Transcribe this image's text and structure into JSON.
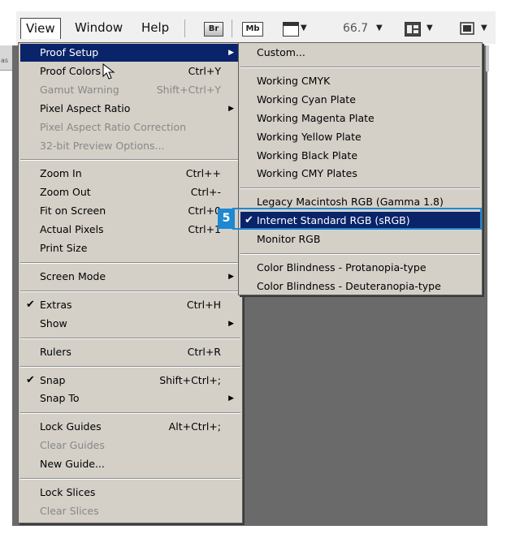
{
  "menubar": {
    "items": [
      "View",
      "Window",
      "Help"
    ],
    "bridge_button": "Br",
    "minibridge_button": "Mb",
    "zoom_value": "66.7",
    "left_sliver_text": "as"
  },
  "view_menu": [
    {
      "label": "Proof Setup",
      "arrow": true,
      "highlight": true
    },
    {
      "label": "Proof Colors",
      "shortcut": "Ctrl+Y"
    },
    {
      "label": "Gamut Warning",
      "shortcut": "Shift+Ctrl+Y",
      "disabled": true
    },
    {
      "label": "Pixel Aspect Ratio",
      "arrow": true
    },
    {
      "label": "Pixel Aspect Ratio Correction",
      "disabled": true
    },
    {
      "label": "32-bit Preview Options...",
      "disabled": true
    },
    {
      "divider": true
    },
    {
      "label": "Zoom In",
      "shortcut": "Ctrl++"
    },
    {
      "label": "Zoom Out",
      "shortcut": "Ctrl+-"
    },
    {
      "label": "Fit on Screen",
      "shortcut": "Ctrl+0"
    },
    {
      "label": "Actual Pixels",
      "shortcut": "Ctrl+1"
    },
    {
      "label": "Print Size"
    },
    {
      "divider": true
    },
    {
      "label": "Screen Mode",
      "arrow": true
    },
    {
      "divider": true
    },
    {
      "label": "Extras",
      "shortcut": "Ctrl+H",
      "checked": true
    },
    {
      "label": "Show",
      "arrow": true
    },
    {
      "divider": true
    },
    {
      "label": "Rulers",
      "shortcut": "Ctrl+R"
    },
    {
      "divider": true
    },
    {
      "label": "Snap",
      "shortcut": "Shift+Ctrl+;",
      "checked": true
    },
    {
      "label": "Snap To",
      "arrow": true
    },
    {
      "divider": true
    },
    {
      "label": "Lock Guides",
      "shortcut": "Alt+Ctrl+;"
    },
    {
      "label": "Clear Guides",
      "disabled": true
    },
    {
      "label": "New Guide..."
    },
    {
      "divider": true
    },
    {
      "label": "Lock Slices"
    },
    {
      "label": "Clear Slices",
      "disabled": true
    }
  ],
  "proof_setup_submenu": [
    {
      "label": "Custom..."
    },
    {
      "divider": true
    },
    {
      "label": "Working CMYK"
    },
    {
      "label": "Working Cyan Plate"
    },
    {
      "label": "Working Magenta Plate"
    },
    {
      "label": "Working Yellow Plate"
    },
    {
      "label": "Working Black Plate"
    },
    {
      "label": "Working CMY Plates"
    },
    {
      "divider": true
    },
    {
      "label": "Legacy Macintosh RGB (Gamma 1.8)"
    },
    {
      "label": "Internet Standard RGB (sRGB)",
      "checked": true,
      "highlight": true
    },
    {
      "label": "Monitor RGB"
    },
    {
      "divider": true
    },
    {
      "label": "Color Blindness - Protanopia-type"
    },
    {
      "label": "Color Blindness - Deuteranopia-type"
    }
  ],
  "callout": {
    "number": "5"
  },
  "colors": {
    "highlight": "#0a246a",
    "menu_bg": "#d4d0c8",
    "callout": "#1e88d2",
    "workspace": "#6a6a6a"
  }
}
